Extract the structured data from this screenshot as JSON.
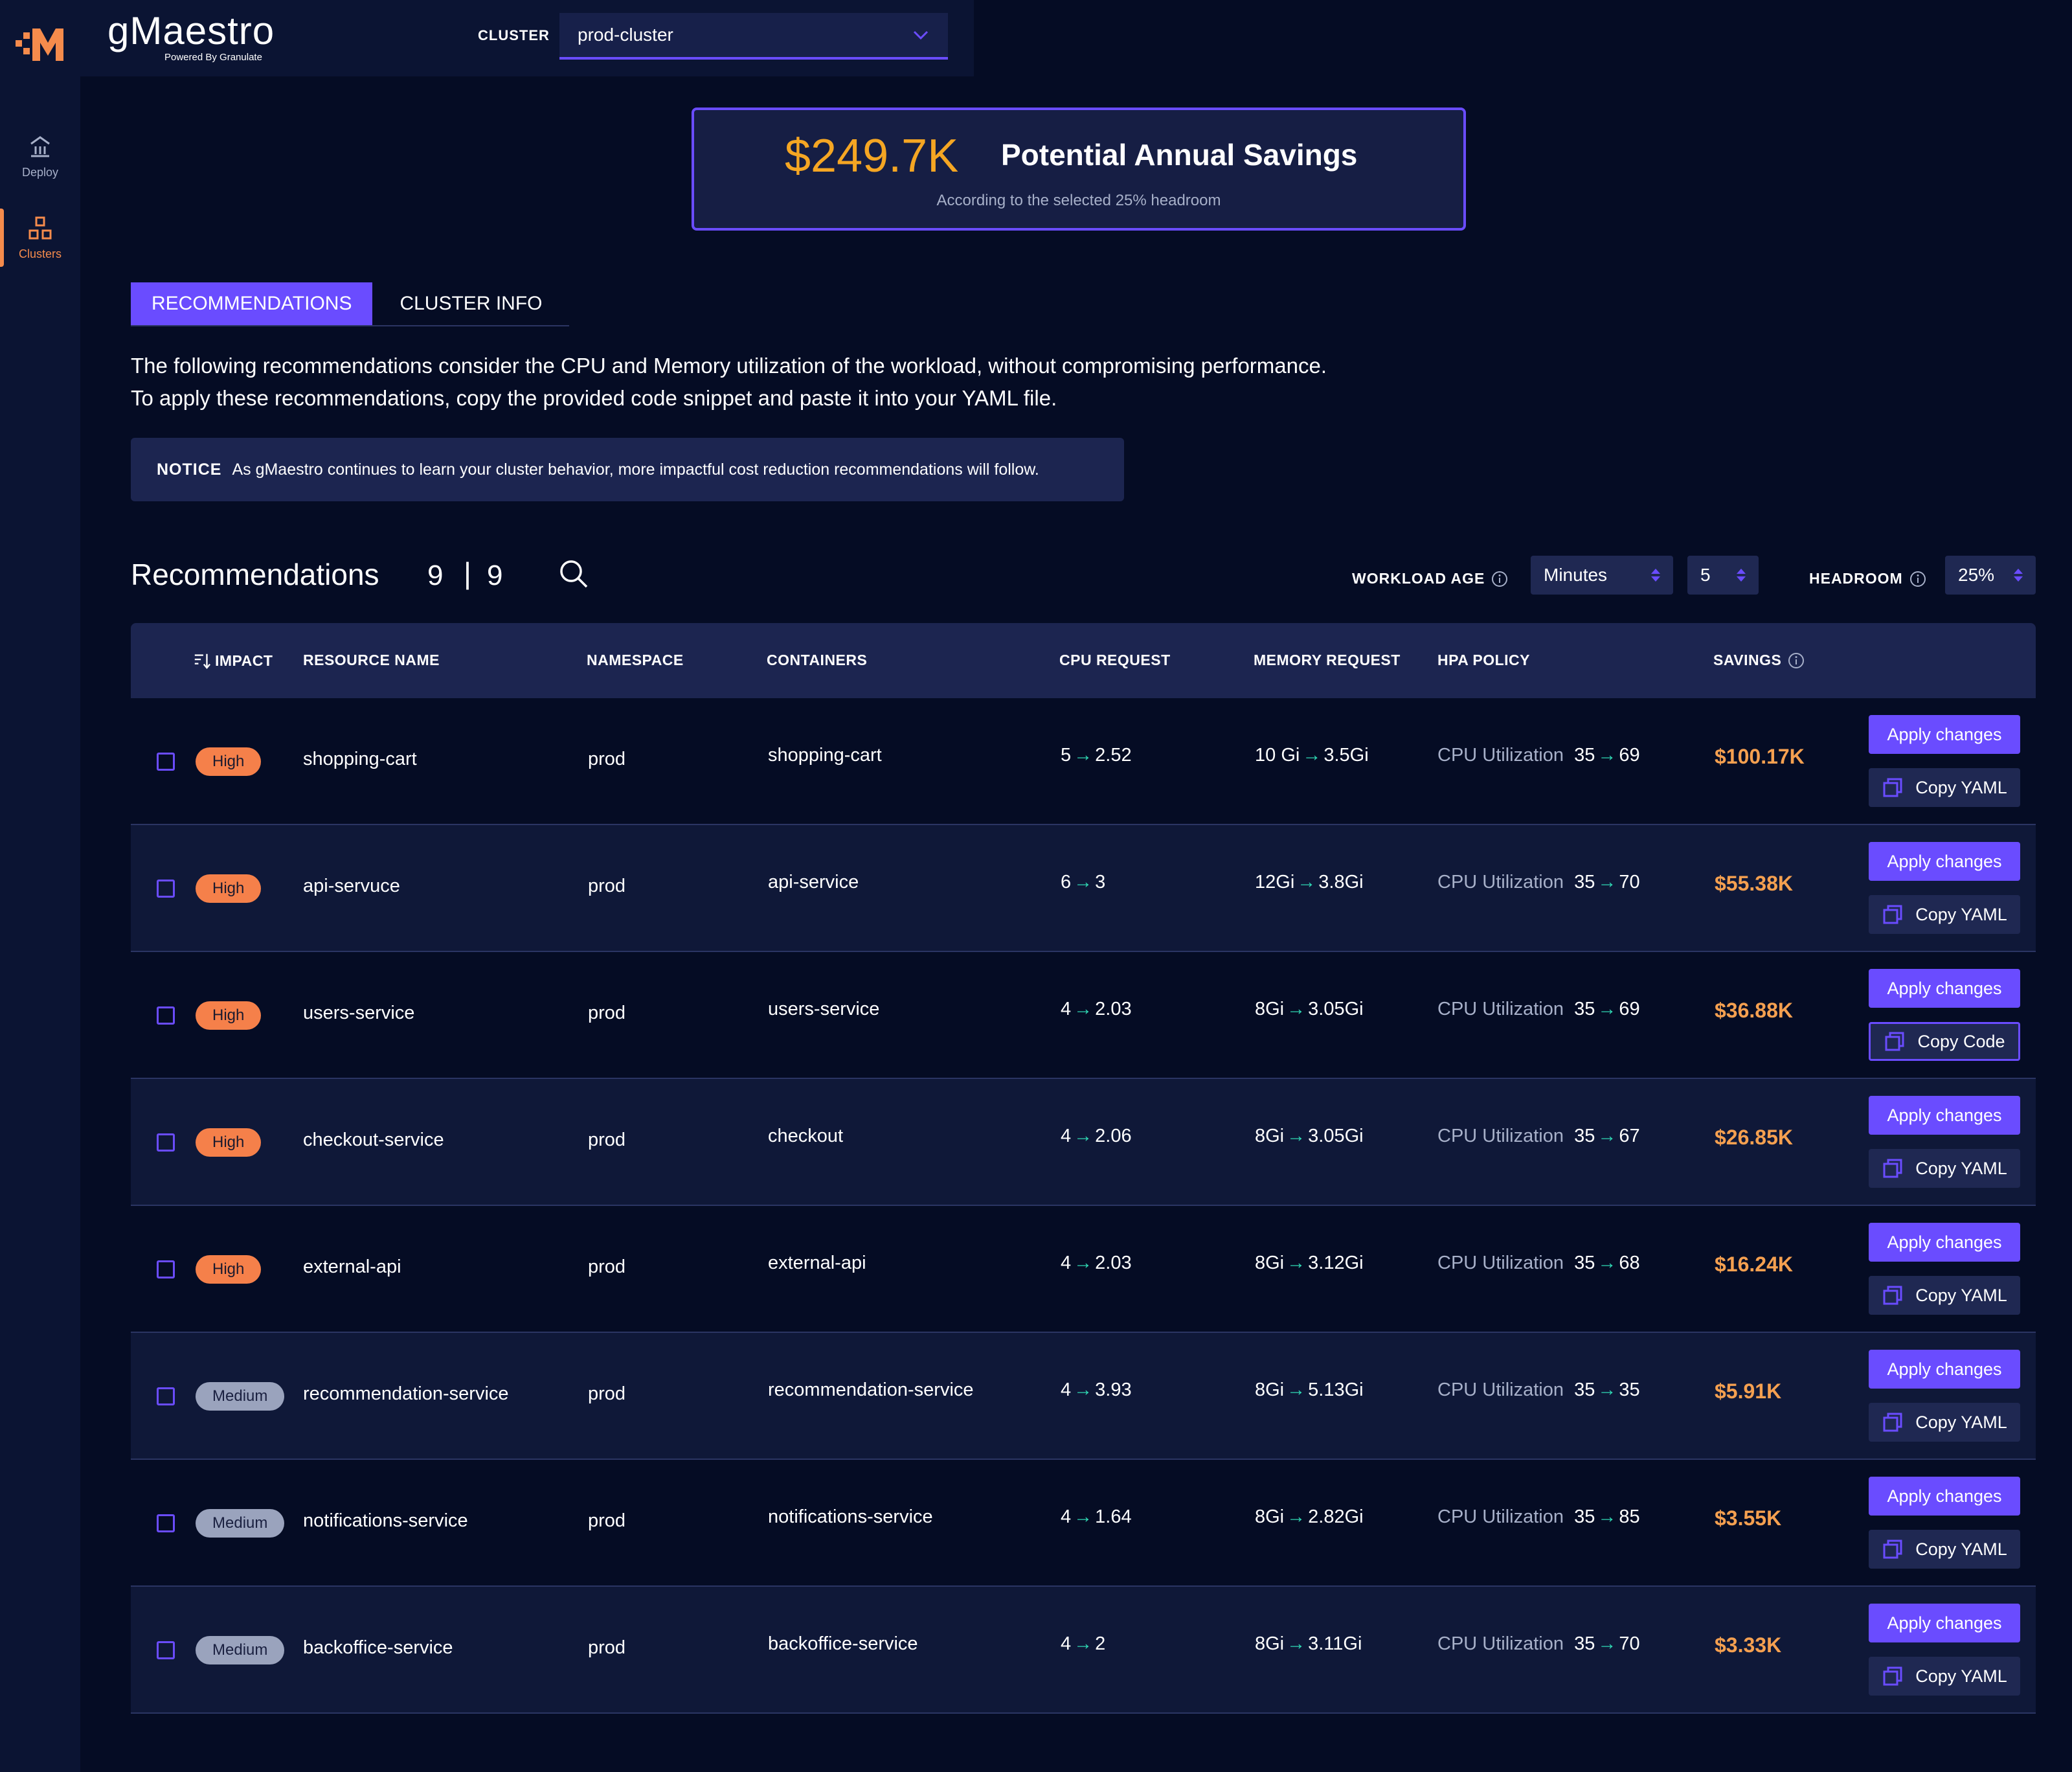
{
  "app": {
    "brand_name": "gMaestro",
    "brand_sub": "Powered By Granulate"
  },
  "sidebar": {
    "items": [
      {
        "label": "Deploy",
        "icon": "deploy-icon",
        "active": false
      },
      {
        "label": "Clusters",
        "icon": "clusters-icon",
        "active": true
      }
    ]
  },
  "header": {
    "cluster_label": "CLUSTER",
    "cluster_value": "prod-cluster"
  },
  "savings": {
    "amount": "$249.7K",
    "title": "Potential Annual Savings",
    "subtitle": "According to the selected 25% headroom"
  },
  "tabs": [
    {
      "label": "RECOMMENDATIONS",
      "active": true
    },
    {
      "label": "CLUSTER INFO",
      "active": false
    }
  ],
  "description": {
    "line1": "The following recommendations consider the CPU and Memory utilization of the workload, without compromising performance.",
    "line2": "To apply these recommendations, copy the provided code snippet and paste it into your YAML file."
  },
  "notice": {
    "label": "NOTICE",
    "text": "As gMaestro continues to learn your cluster behavior, more impactful cost reduction recommendations will follow."
  },
  "recommendations": {
    "title": "Recommendations",
    "count_shown": "9",
    "separator": "|",
    "count_total": "9"
  },
  "filters": {
    "workload_age_label": "WORKLOAD AGE",
    "unit_value": "Minutes",
    "age_value": "5",
    "headroom_label": "HEADROOM",
    "headroom_value": "25%"
  },
  "table": {
    "columns": {
      "impact": "IMPACT",
      "resource": "RESOURCE NAME",
      "namespace": "NAMESPACE",
      "containers": "CONTAINERS",
      "cpu": "CPU REQUEST",
      "memory": "MEMORY REQUEST",
      "hpa": "HPA POLICY",
      "savings": "SAVINGS"
    },
    "arrow": "→",
    "apply_label": "Apply changes",
    "rows": [
      {
        "impact": "High",
        "resource": "shopping-cart",
        "namespace": "prod",
        "container": "shopping-cart",
        "cpu_from": "5",
        "cpu_to": "2.52",
        "mem_from": "10 Gi",
        "mem_to": "3.5Gi",
        "hpa_label": "CPU Utilization",
        "hpa_from": "35",
        "hpa_to": "69",
        "savings": "$100.17K",
        "copy_label": "Copy YAML"
      },
      {
        "impact": "High",
        "resource": "api-servuce",
        "namespace": "prod",
        "container": "api-service",
        "cpu_from": "6",
        "cpu_to": "3",
        "mem_from": "12Gi",
        "mem_to": "3.8Gi",
        "hpa_label": "CPU Utilization",
        "hpa_from": "35",
        "hpa_to": "70",
        "savings": "$55.38K",
        "copy_label": "Copy YAML"
      },
      {
        "impact": "High",
        "resource": "users-service",
        "namespace": "prod",
        "container": "users-service",
        "cpu_from": "4",
        "cpu_to": "2.03",
        "mem_from": "8Gi",
        "mem_to": "3.05Gi",
        "hpa_label": "CPU Utilization",
        "hpa_from": "35",
        "hpa_to": "69",
        "savings": "$36.88K",
        "copy_label": "Copy Code"
      },
      {
        "impact": "High",
        "resource": "checkout-service",
        "namespace": "prod",
        "container": "checkout",
        "cpu_from": "4",
        "cpu_to": "2.06",
        "mem_from": "8Gi",
        "mem_to": "3.05Gi",
        "hpa_label": "CPU Utilization",
        "hpa_from": "35",
        "hpa_to": "67",
        "savings": "$26.85K",
        "copy_label": "Copy YAML"
      },
      {
        "impact": "High",
        "resource": "external-api",
        "namespace": "prod",
        "container": "external-api",
        "cpu_from": "4",
        "cpu_to": "2.03",
        "mem_from": "8Gi",
        "mem_to": "3.12Gi",
        "hpa_label": "CPU Utilization",
        "hpa_from": "35",
        "hpa_to": "68",
        "savings": "$16.24K",
        "copy_label": "Copy YAML"
      },
      {
        "impact": "Medium",
        "resource": "recommendation-service",
        "namespace": "prod",
        "container": "recommendation-service",
        "cpu_from": "4",
        "cpu_to": "3.93",
        "mem_from": "8Gi",
        "mem_to": "5.13Gi",
        "hpa_label": "CPU Utilization",
        "hpa_from": "35",
        "hpa_to": "35",
        "savings": "$5.91K",
        "copy_label": "Copy YAML"
      },
      {
        "impact": "Medium",
        "resource": "notifications-service",
        "namespace": "prod",
        "container": "notifications-service",
        "cpu_from": "4",
        "cpu_to": "1.64",
        "mem_from": "8Gi",
        "mem_to": "2.82Gi",
        "hpa_label": "CPU Utilization",
        "hpa_from": "35",
        "hpa_to": "85",
        "savings": "$3.55K",
        "copy_label": "Copy YAML"
      },
      {
        "impact": "Medium",
        "resource": "backoffice-service",
        "namespace": "prod",
        "container": "backoffice-service",
        "cpu_from": "4",
        "cpu_to": "2",
        "mem_from": "8Gi",
        "mem_to": "3.11Gi",
        "hpa_label": "CPU Utilization",
        "hpa_from": "35",
        "hpa_to": "70",
        "savings": "$3.33K",
        "copy_label": "Copy YAML"
      }
    ]
  },
  "colors": {
    "background": "#050c24",
    "accent": "#6a4cff",
    "savings": "#f5a623",
    "high_badge": "#f5804a",
    "medium_badge": "#9aa3bd",
    "arrow": "#2fd6b2"
  }
}
